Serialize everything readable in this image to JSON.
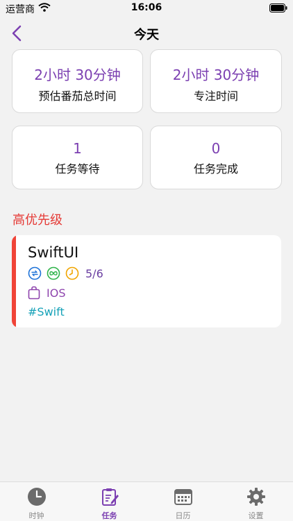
{
  "status_bar": {
    "carrier": "运营商",
    "time": "16:06"
  },
  "nav": {
    "title": "今天",
    "back_icon": "chevron-left-icon"
  },
  "stats": [
    {
      "value": "2小时 30分钟",
      "label": "预估番茄总时间"
    },
    {
      "value": "2小时 30分钟",
      "label": "专注时间"
    },
    {
      "value": "1",
      "label": "任务等待"
    },
    {
      "value": "0",
      "label": "任务完成"
    }
  ],
  "section": {
    "title": "高优先级",
    "color": "#e53935"
  },
  "task": {
    "title": "SwiftUI",
    "pomodoro_count": "5/6",
    "project": "IOS",
    "tag": "#Swift",
    "priority_color": "#f04438",
    "icons": [
      "repeat-icon",
      "infinity-icon",
      "clock-icon",
      "bag-icon"
    ]
  },
  "tabbar": {
    "tabs": [
      {
        "label": "时钟",
        "icon": "clock-icon"
      },
      {
        "label": "任务",
        "icon": "task-edit-icon",
        "active": true
      },
      {
        "label": "日历",
        "icon": "calendar-icon"
      },
      {
        "label": "设置",
        "icon": "gear-icon"
      }
    ]
  },
  "colors": {
    "accent": "#7b3fb1",
    "background": "#f2f2f2"
  }
}
